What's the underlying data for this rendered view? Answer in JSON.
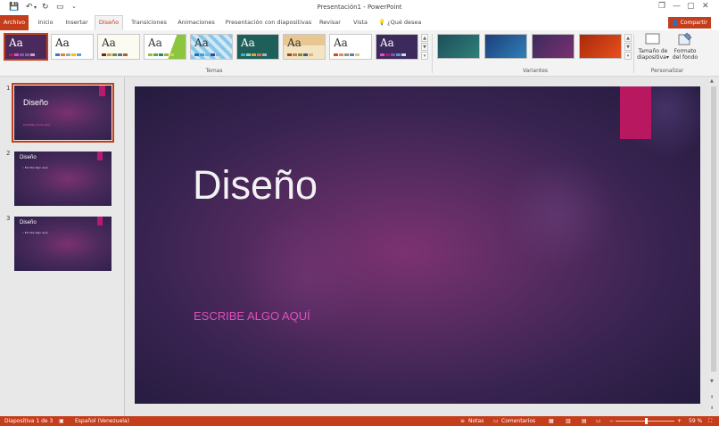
{
  "window": {
    "title": "Presentación1 - PowerPoint",
    "controls": {
      "restore": "❐",
      "minimize": "—",
      "maximize": "▢",
      "close": "✕"
    }
  },
  "quick_access": {
    "save": "💾",
    "undo": "↶",
    "undo_dropdown": "▾",
    "redo": "↻",
    "present": "▭",
    "customize": "⌄"
  },
  "tabs": [
    {
      "label": "Archivo"
    },
    {
      "label": "Inicio"
    },
    {
      "label": "Insertar"
    },
    {
      "label": "Diseño"
    },
    {
      "label": "Transiciones"
    },
    {
      "label": "Animaciones"
    },
    {
      "label": "Presentación con diapositivas"
    },
    {
      "label": "Revisar"
    },
    {
      "label": "Vista"
    }
  ],
  "active_tab": "Diseño",
  "tell_me": {
    "icon": "lightbulb-icon",
    "glyph": "💡",
    "placeholder": "¿Qué desea hacer?"
  },
  "share": {
    "label": "Compartir",
    "glyph": "👤"
  },
  "ribbon": {
    "themes_label": "Temas",
    "variants_label": "Variantes",
    "customize_label": "Personalizar",
    "theme_glyph": "Aa",
    "gallery_up": "▲",
    "gallery_down": "▼",
    "gallery_more": "▾",
    "slide_size": {
      "line1": "Tamaño de",
      "line2": "diapositiva",
      "arrow": "▾"
    },
    "format_background": {
      "line1": "Formato",
      "line2": "del fondo"
    }
  },
  "thumbnails": [
    {
      "number": "1",
      "title": "Diseño",
      "subtitle": "ESCRIBE ALGO AQUÍ"
    },
    {
      "number": "2",
      "title": "Diseño",
      "bullet": "• Escribe algo aquí"
    },
    {
      "number": "3",
      "title": "Diseño",
      "bullet": "• Escribe algo aquí"
    }
  ],
  "slide": {
    "title": "Diseño",
    "subtitle": "ESCRIBE ALGO AQUÍ"
  },
  "scrollbar": {
    "up": "▲",
    "down": "▼",
    "page_up": "⇞",
    "page_down": "⇟"
  },
  "status": {
    "slide_info": "Diapositiva 1 de 3",
    "language": "Español (Venezuela)",
    "notes": "Notas",
    "comments": "Comentarios",
    "zoom_minus": "−",
    "zoom_plus": "+",
    "zoom": "59 %",
    "zoom_fraction": 0.52,
    "fit": "⛶",
    "spell_icon": "▣",
    "notes_icon": "≡",
    "comments_icon": "▭",
    "view_normal": "▦",
    "view_sorter": "▥",
    "view_reading": "▤",
    "view_slideshow": "▭"
  },
  "colors": {
    "accent": "#c43e1c",
    "slide_accent": "#b7185f",
    "subtitle": "#e24fbe"
  }
}
